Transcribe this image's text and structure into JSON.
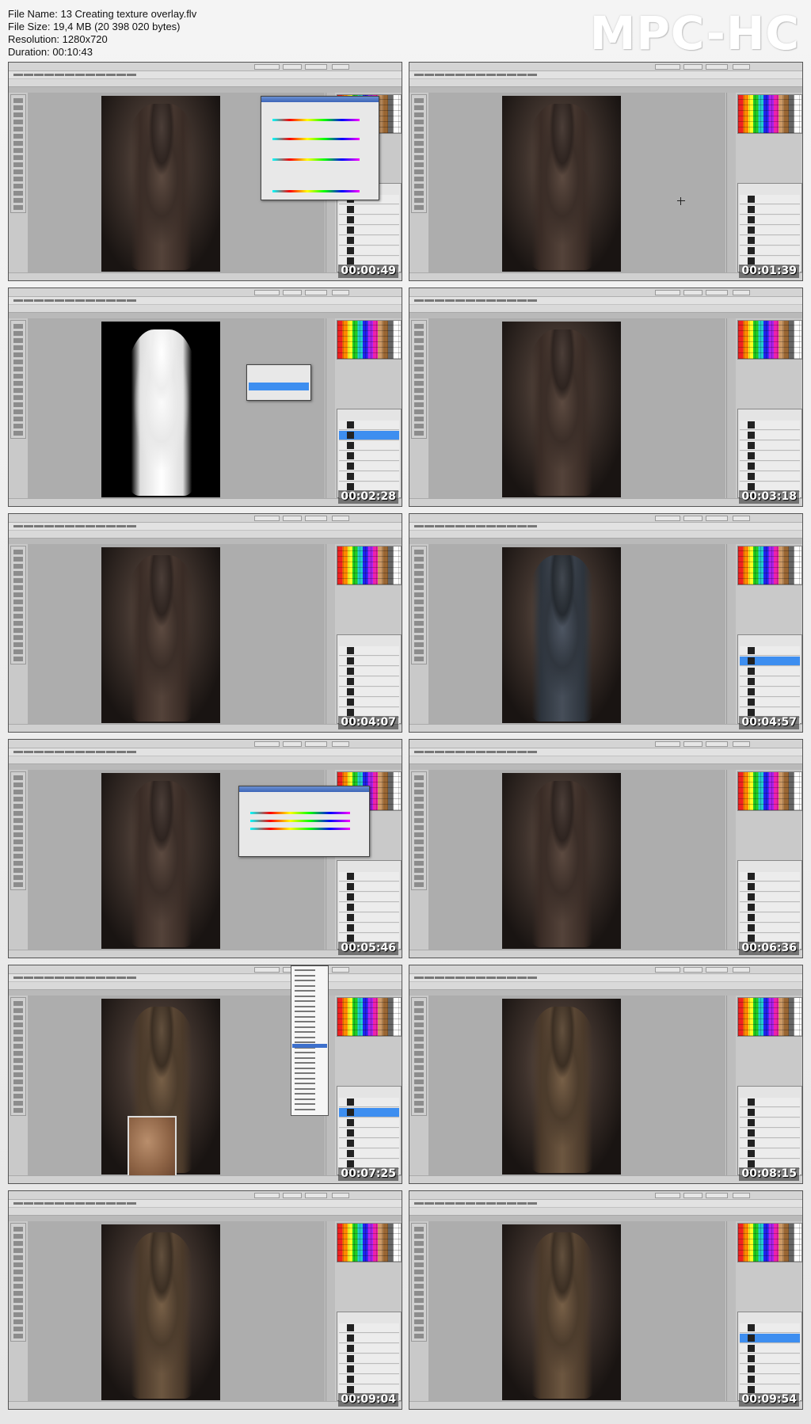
{
  "info": {
    "file_name": "File Name: 13 Creating texture overlay.flv",
    "file_size": "File Size: 19,4 MB (20 398 020 bytes)",
    "resolution": "Resolution: 1280x720",
    "duration": "Duration: 00:10:43"
  },
  "logo": "MPC-HC",
  "thumbnails": [
    {
      "timestamp": "00:00:49",
      "variant": "huesat-dialog"
    },
    {
      "timestamp": "00:01:39",
      "variant": "plain"
    },
    {
      "timestamp": "00:02:28",
      "variant": "depth-mask"
    },
    {
      "timestamp": "00:03:18",
      "variant": "plain"
    },
    {
      "timestamp": "00:04:07",
      "variant": "plain"
    },
    {
      "timestamp": "00:04:57",
      "variant": "blue-lit"
    },
    {
      "timestamp": "00:05:46",
      "variant": "color-balance-dialog"
    },
    {
      "timestamp": "00:06:36",
      "variant": "plain"
    },
    {
      "timestamp": "00:07:25",
      "variant": "texture-patch"
    },
    {
      "timestamp": "00:08:15",
      "variant": "warm"
    },
    {
      "timestamp": "00:09:04",
      "variant": "warm"
    },
    {
      "timestamp": "00:09:54",
      "variant": "warm"
    }
  ]
}
